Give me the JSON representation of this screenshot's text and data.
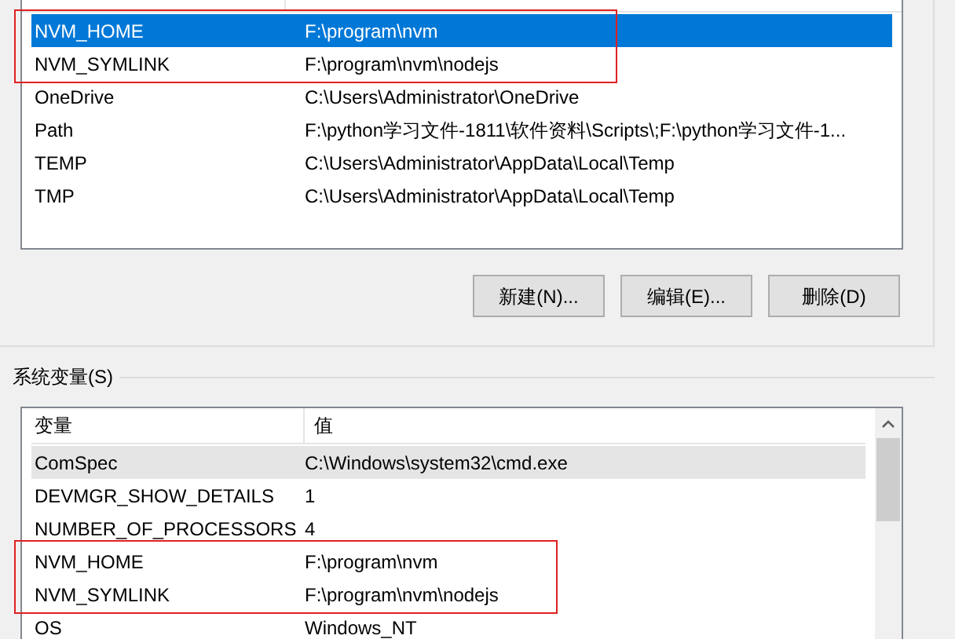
{
  "user_variables": {
    "rows": [
      {
        "name": "NVM_HOME",
        "value": "F:\\program\\nvm",
        "selected": true,
        "outlined": true
      },
      {
        "name": "NVM_SYMLINK",
        "value": "F:\\program\\nvm\\nodejs",
        "selected": false,
        "outlined": true
      },
      {
        "name": "OneDrive",
        "value": "C:\\Users\\Administrator\\OneDrive",
        "selected": false,
        "outlined": false
      },
      {
        "name": "Path",
        "value": "F:\\python学习文件-1811\\软件资料\\Scripts\\;F:\\python学习文件-1...",
        "selected": false,
        "outlined": false
      },
      {
        "name": "TEMP",
        "value": "C:\\Users\\Administrator\\AppData\\Local\\Temp",
        "selected": false,
        "outlined": false
      },
      {
        "name": "TMP",
        "value": "C:\\Users\\Administrator\\AppData\\Local\\Temp",
        "selected": false,
        "outlined": false
      }
    ],
    "buttons": [
      "新建(N)...",
      "编辑(E)...",
      "删除(D)"
    ]
  },
  "system_variables": {
    "label": "系统变量(S)",
    "columns": [
      "变量",
      "值"
    ],
    "rows": [
      {
        "name": "ComSpec",
        "value": "C:\\Windows\\system32\\cmd.exe",
        "selected": true,
        "outlined": false
      },
      {
        "name": "DEVMGR_SHOW_DETAILS",
        "value": "1",
        "selected": false,
        "outlined": false
      },
      {
        "name": "NUMBER_OF_PROCESSORS",
        "value": "4",
        "selected": false,
        "outlined": false
      },
      {
        "name": "NVM_HOME",
        "value": "F:\\program\\nvm",
        "selected": false,
        "outlined": true
      },
      {
        "name": "NVM_SYMLINK",
        "value": "F:\\program\\nvm\\nodejs",
        "selected": false,
        "outlined": true
      },
      {
        "name": "OS",
        "value": "Windows_NT",
        "selected": false,
        "outlined": false
      }
    ]
  }
}
